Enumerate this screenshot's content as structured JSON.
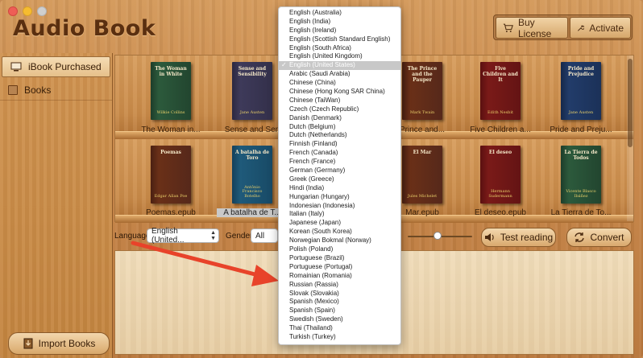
{
  "app": {
    "title": "Audio Book"
  },
  "toolbar": {
    "buy_license": "Buy License",
    "activate": "Activate"
  },
  "sidebar": {
    "items": [
      {
        "label": "iBook Purchased",
        "icon": "computer-icon"
      },
      {
        "label": "Books",
        "icon": "book-icon"
      }
    ],
    "import_label": "Import Books"
  },
  "shelf": {
    "row1": [
      {
        "title": "The Woman in White",
        "author": "Wilkie Collins",
        "label": "The Woman in...",
        "color": "green"
      },
      {
        "title": "Sense and Sensibility",
        "author": "Jane Austen",
        "label": "Sense and Sen",
        "color": "purple"
      },
      {
        "title": "The Prince and the Pauper",
        "author": "Mark Twain",
        "label": "Prince and...",
        "color": "brown"
      },
      {
        "title": "Five Children and It",
        "author": "Edith Nesbit",
        "label": "Five Children a...",
        "color": "red"
      },
      {
        "title": "Pride and Prejudice",
        "author": "Jane Austen",
        "label": "Pride and Preju...",
        "color": "blue"
      }
    ],
    "row2": [
      {
        "title": "Poemas",
        "author": "Edgar Allan Poe",
        "label": "Poemas.epub",
        "color": "brown"
      },
      {
        "title": "A batalha de Toro",
        "author": "Antônio Francisco Botelho",
        "label": "A batalha de T...",
        "color": "teal"
      },
      {
        "title": "El Mar",
        "author": "Jules Michelet",
        "label": "Mar.epub",
        "color": "brown"
      },
      {
        "title": "El deseo",
        "author": "Hermann Sudermann",
        "label": "El deseo.epub",
        "color": "red"
      },
      {
        "title": "La Tierra de Todos",
        "author": "Vicente Blasco Ibáñez",
        "label": "La Tierra de To...",
        "color": "green"
      }
    ]
  },
  "controls": {
    "language_label": "Language",
    "language_value": "English (United...",
    "gender_label": "Gender",
    "gender_value": "All",
    "test_reading": "Test reading",
    "convert": "Convert"
  },
  "language_menu": {
    "selected": "English (United States)",
    "items": [
      "English (Australia)",
      "English (India)",
      "English (Ireland)",
      "English (Scottish Standard English)",
      "English (South Africa)",
      "English (United Kingdom)",
      "English (United States)",
      "Arabic (Saudi Arabia)",
      "Chinese (China)",
      "Chinese (Hong Kong SAR China)",
      "Chinese (TaiWan)",
      "Czech (Czech Republic)",
      "Danish (Denmark)",
      "Dutch (Belgium)",
      "Dutch (Netherlands)",
      "Finnish (Finland)",
      "French (Canada)",
      "French (France)",
      "German (Germany)",
      "Greek (Greece)",
      "Hindi (India)",
      "Hungarian (Hungary)",
      "Indonesian (Indonesia)",
      "Italian (Italy)",
      "Japanese (Japan)",
      "Korean (South Korea)",
      "Norwegian Bokmal (Norway)",
      "Polish (Poland)",
      "Portuguese (Brazil)",
      "Portuguese (Portugal)",
      "Romainian (Romania)",
      "Russian (Rassia)",
      "Slovak (Slovakia)",
      "Spanish (Mexico)",
      "Spanish (Spain)",
      "Swedish (Sweden)",
      "Thai (Thailand)",
      "Turkish (Turkey)"
    ]
  },
  "colors": {
    "wood": "#c8884a",
    "arrow": "#e8432a",
    "title_text": "#5a2f10"
  }
}
